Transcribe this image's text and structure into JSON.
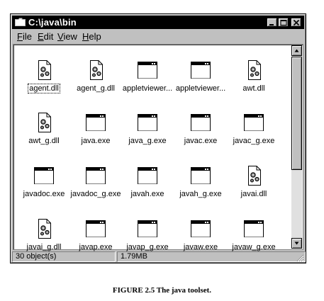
{
  "window": {
    "title": "C:\\java\\bin",
    "menus": [
      "File",
      "Edit",
      "View",
      "Help"
    ],
    "menu_accels": [
      "F",
      "E",
      "V",
      "H"
    ]
  },
  "files": [
    {
      "name": "agent.dll",
      "type": "dll",
      "focused": true
    },
    {
      "name": "agent_g.dll",
      "type": "dll"
    },
    {
      "name": "appletviewer...",
      "type": "exe"
    },
    {
      "name": "appletviewer...",
      "type": "exe"
    },
    {
      "name": "awt.dll",
      "type": "dll"
    },
    {
      "name": "awt_g.dll",
      "type": "dll"
    },
    {
      "name": "java.exe",
      "type": "exe"
    },
    {
      "name": "java_g.exe",
      "type": "exe"
    },
    {
      "name": "javac.exe",
      "type": "exe"
    },
    {
      "name": "javac_g.exe",
      "type": "exe"
    },
    {
      "name": "javadoc.exe",
      "type": "exe"
    },
    {
      "name": "javadoc_g.exe",
      "type": "exe"
    },
    {
      "name": "javah.exe",
      "type": "exe"
    },
    {
      "name": "javah_g.exe",
      "type": "exe"
    },
    {
      "name": "javai.dll",
      "type": "dll"
    },
    {
      "name": "javai_g.dll",
      "type": "dll"
    },
    {
      "name": "javap.exe",
      "type": "exe"
    },
    {
      "name": "javap_g.exe",
      "type": "exe"
    },
    {
      "name": "javaw.exe",
      "type": "exe"
    },
    {
      "name": "javaw_g.exe",
      "type": "exe"
    }
  ],
  "status": {
    "objects": "30 object(s)",
    "size": "1.79MB"
  },
  "caption": "FIGURE 2.5  The java toolset.",
  "scrollbar": {
    "position": 0,
    "visible_fraction": 0.66
  }
}
